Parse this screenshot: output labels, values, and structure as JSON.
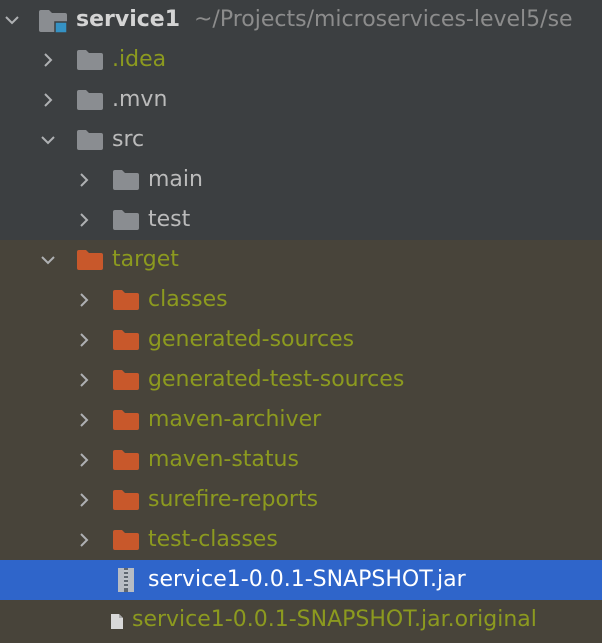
{
  "colors": {
    "background": "#3c3f41",
    "excluded_background": "#48443a",
    "selection": "#2f65ca",
    "folder_gray": "#8a8d91",
    "folder_orange": "#c8582b",
    "ignored_text": "#8c9a1f"
  },
  "tree": {
    "root": {
      "name": "service1",
      "path": "~/Projects/microservices-level5/se",
      "icon": "module-folder-icon",
      "expanded": true
    },
    "items": [
      {
        "name": ".idea",
        "icon": "folder-icon",
        "expanded": false
      },
      {
        "name": ".mvn",
        "icon": "folder-icon",
        "expanded": false
      },
      {
        "name": "src",
        "icon": "folder-icon",
        "expanded": true
      },
      {
        "name": "main",
        "icon": "folder-icon",
        "expanded": false
      },
      {
        "name": "test",
        "icon": "folder-icon",
        "expanded": false
      },
      {
        "name": "target",
        "icon": "excluded-folder-icon",
        "expanded": true
      },
      {
        "name": "classes",
        "icon": "excluded-folder-icon",
        "expanded": false
      },
      {
        "name": "generated-sources",
        "icon": "excluded-folder-icon",
        "expanded": false
      },
      {
        "name": "generated-test-sources",
        "icon": "excluded-folder-icon",
        "expanded": false
      },
      {
        "name": "maven-archiver",
        "icon": "excluded-folder-icon",
        "expanded": false
      },
      {
        "name": "maven-status",
        "icon": "excluded-folder-icon",
        "expanded": false
      },
      {
        "name": "surefire-reports",
        "icon": "excluded-folder-icon",
        "expanded": false
      },
      {
        "name": "test-classes",
        "icon": "excluded-folder-icon",
        "expanded": false
      },
      {
        "name": "service1-0.0.1-SNAPSHOT.jar",
        "icon": "jar-file-icon",
        "selected": true
      },
      {
        "name": "service1-0.0.1-SNAPSHOT.jar.original",
        "icon": "file-icon"
      }
    ]
  }
}
